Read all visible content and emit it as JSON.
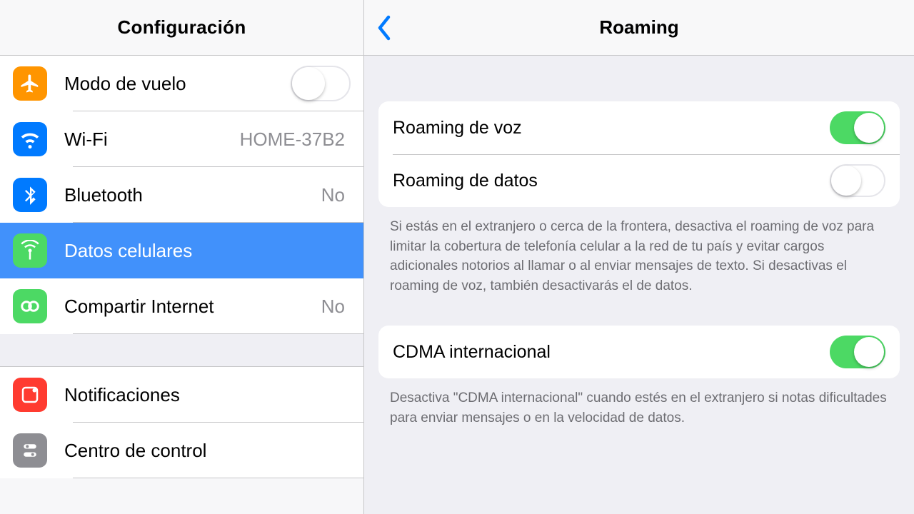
{
  "sidebar": {
    "title": "Configuración",
    "items": [
      {
        "label": "Modo de vuelo",
        "value": "",
        "toggle": false
      },
      {
        "label": "Wi-Fi",
        "value": "HOME-37B2"
      },
      {
        "label": "Bluetooth",
        "value": "No"
      },
      {
        "label": "Datos celulares",
        "value": ""
      },
      {
        "label": "Compartir Internet",
        "value": "No"
      },
      {
        "label": "Notificaciones",
        "value": ""
      },
      {
        "label": "Centro de control",
        "value": ""
      }
    ]
  },
  "detail": {
    "title": "Roaming",
    "rows": [
      {
        "label": "Roaming de voz",
        "on": true
      },
      {
        "label": "Roaming de datos",
        "on": false
      }
    ],
    "footer1": "Si estás en el extranjero o cerca de la frontera, desactiva el roaming de voz para limitar la cobertura de telefonía celular a la red de tu país y evitar cargos adicionales notorios al llamar o al enviar mensajes de texto. Si desactivas el roaming de voz, también desactivarás el de datos.",
    "rows2": [
      {
        "label": "CDMA internacional",
        "on": true
      }
    ],
    "footer2": "Desactiva \"CDMA internacional\" cuando estés en el extranjero si notas dificultades para enviar mensajes o en la velocidad de datos."
  }
}
